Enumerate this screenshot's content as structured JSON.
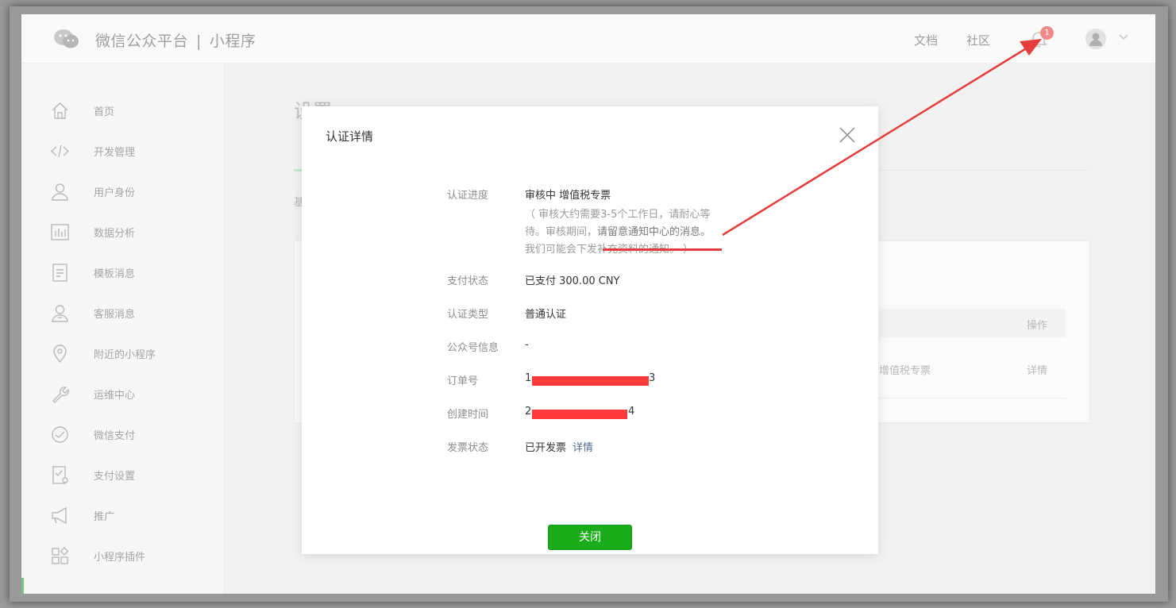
{
  "header": {
    "brand_main": "微信公众平台",
    "brand_sep": "|",
    "brand_sub": "小程序",
    "nav_docs": "文档",
    "nav_community": "社区",
    "notification_count": "1"
  },
  "sidebar": {
    "items": [
      {
        "label": "首页",
        "icon": "home-icon"
      },
      {
        "label": "开发管理",
        "icon": "code-icon"
      },
      {
        "label": "用户身份",
        "icon": "user-icon"
      },
      {
        "label": "数据分析",
        "icon": "chart-icon"
      },
      {
        "label": "模板消息",
        "icon": "document-icon"
      },
      {
        "label": "客服消息",
        "icon": "support-icon"
      },
      {
        "label": "附近的小程序",
        "icon": "location-icon"
      },
      {
        "label": "运维中心",
        "icon": "wrench-icon"
      },
      {
        "label": "微信支付",
        "icon": "wechat-pay-icon"
      },
      {
        "label": "支付设置",
        "icon": "payment-settings-icon"
      },
      {
        "label": "推广",
        "icon": "megaphone-icon"
      },
      {
        "label": "小程序插件",
        "icon": "plugin-icon"
      }
    ]
  },
  "background": {
    "title": "设置",
    "tab_hint": "基",
    "col_action": "操作",
    "row_type": "增值税专票",
    "row_action": "详情"
  },
  "modal": {
    "title": "认证详情",
    "rows": {
      "progress_label": "认证进度",
      "progress_value": "审核中 增值税专票",
      "progress_note_line1": "（ 审核大约需要3-5个工作日，请耐心等",
      "progress_note_line2a": "待。审核期间，",
      "progress_note_line2b": "请留意通知中心的消息。",
      "progress_note_line3": "我们可能会下发补充资料的通知。 ）",
      "payment_label": "支付状态",
      "payment_value": "已支付 300.00 CNY",
      "type_label": "认证类型",
      "type_value": "普通认证",
      "account_label": "公众号信息",
      "account_value": "-",
      "order_label": "订单号",
      "order_prefix": "1",
      "order_suffix": "3",
      "created_label": "创建时间",
      "created_prefix": "2",
      "created_suffix": "4",
      "invoice_label": "发票状态",
      "invoice_value": "已开发票",
      "invoice_link": "详情"
    },
    "close_button": "关闭"
  },
  "colors": {
    "accent_green": "#1aad19",
    "link_blue": "#576b95",
    "annotation_red": "#e43d3d"
  }
}
